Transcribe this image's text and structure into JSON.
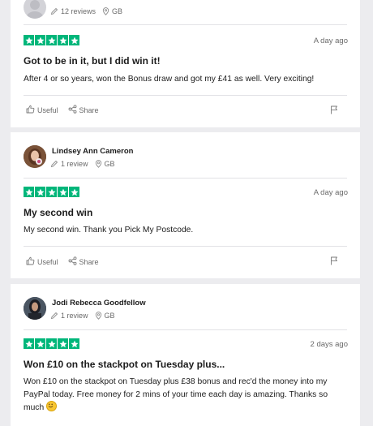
{
  "reviews": [
    {
      "reviewer": {
        "name": "",
        "review_count": "12 reviews",
        "country": "GB"
      },
      "rating": 5,
      "date": "A day ago",
      "title": "Got to be in it, but I did win it!",
      "body": "After 4 or so years, won the Bonus draw and got my £41 as well. Very exciting!",
      "actions": {
        "useful": "Useful",
        "share": "Share"
      }
    },
    {
      "reviewer": {
        "name": "Lindsey Ann Cameron",
        "review_count": "1 review",
        "country": "GB"
      },
      "rating": 5,
      "date": "A day ago",
      "title": "My second win",
      "body": "My second win. Thank you Pick My Postcode.",
      "actions": {
        "useful": "Useful",
        "share": "Share"
      }
    },
    {
      "reviewer": {
        "name": "Jodi Rebecca Goodfellow",
        "review_count": "1 review",
        "country": "GB"
      },
      "rating": 5,
      "date": "2 days ago",
      "title": "Won £10 on the stackpot on Tuesday plus...",
      "body": "Won £10 on the stackpot on Tuesday plus £38 bonus and rec'd the money into my PayPal today. Free money for 2 mins of your time each day is amazing. Thanks so much",
      "body_emoji": "smiling-face-emoji"
    }
  ],
  "colors": {
    "star_green": "#00b67a",
    "page_bg": "#ececef",
    "card_bg": "#ffffff",
    "muted_text": "#6a6a6a"
  },
  "icons": [
    "pencil-icon",
    "location-pin-icon",
    "star-icon",
    "thumbs-up-icon",
    "share-icon",
    "flag-icon"
  ]
}
